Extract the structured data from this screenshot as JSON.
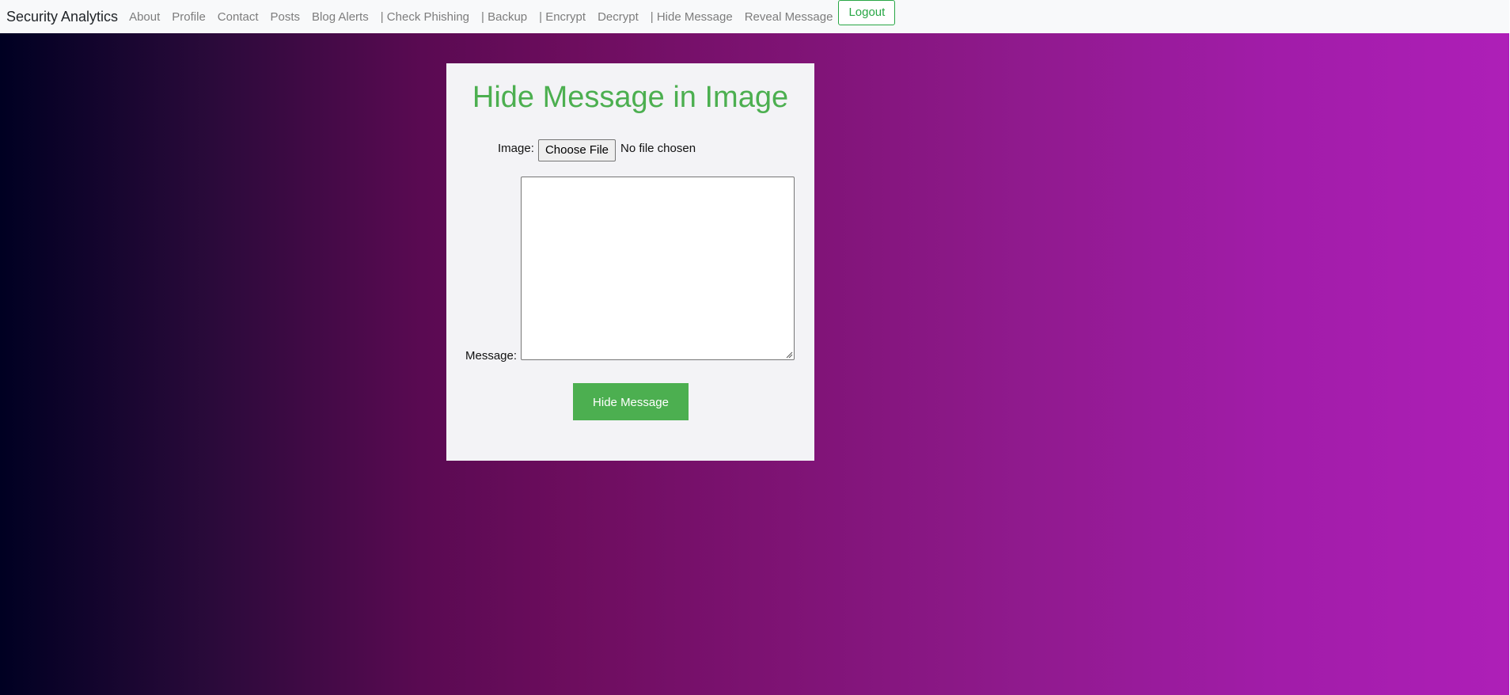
{
  "navbar": {
    "brand": "Security Analytics",
    "links": [
      "About",
      "Profile",
      "Contact",
      "Posts",
      "Blog Alerts",
      "| Check Phishing",
      "| Backup",
      "| Encrypt",
      "Decrypt",
      "| Hide Message",
      "Reveal Message"
    ],
    "logout_label": "Logout"
  },
  "form": {
    "title": "Hide Message in Image",
    "image_label": "Image:",
    "file_button_label": "Choose File",
    "file_status": "No file chosen",
    "message_label": "Message:",
    "message_value": "",
    "submit_label": "Hide Message"
  },
  "colors": {
    "accent_green": "#4caf50",
    "logout_green": "#28a745",
    "navbar_bg": "#f8f9fa",
    "card_bg": "#f3f3f6"
  }
}
